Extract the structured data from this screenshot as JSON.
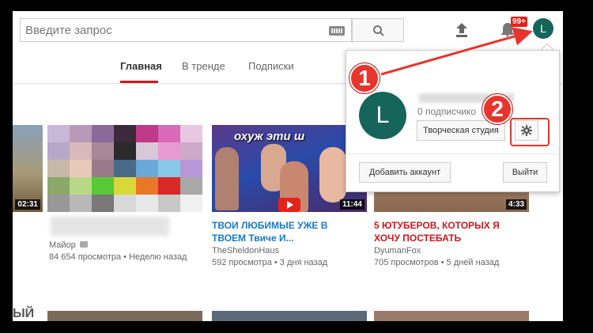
{
  "header": {
    "search_placeholder": "Введите запрос",
    "notification_badge": "99+",
    "avatar_letter": "L"
  },
  "tabs": [
    {
      "label": "Главная",
      "active": true
    },
    {
      "label": "В тренде",
      "active": false
    },
    {
      "label": "Подписки",
      "active": false
    }
  ],
  "videos": [
    {
      "duration": "02:31",
      "title": "",
      "channel": "",
      "views": "",
      "age": ""
    },
    {
      "duration": "",
      "title": "",
      "channel": "Майор",
      "views": "84 654 просмотра",
      "age": "Неделю назад"
    },
    {
      "duration": "11:44",
      "thumb_text": "охуж эти ш",
      "title": "ТВОИ ЛЮБИМЫЕ УЖЕ В ТВОЕМ Твиче И...",
      "channel": "TheSheldonHaus",
      "views": "592 просмотра",
      "age": "3 дня назад"
    },
    {
      "duration": "4:33",
      "title": "5 ЮТУБЕРОВ, КОТОРЫХ Я ХОЧУ ПОСТЕБАТЬ",
      "channel": "DyumanFox",
      "views": "705 просмотров",
      "age": "5 дней назад"
    }
  ],
  "popup": {
    "avatar_letter": "L",
    "subscribers": "0 подписчико",
    "studio_button": "Творческая студия",
    "add_account": "Добавить аккаунт",
    "logout": "Выйти"
  },
  "annotations": {
    "step1": "1",
    "step2": "2",
    "accent_color": "#e8342c"
  },
  "bottom_row": {
    "partial_text": "ЫЙ"
  }
}
